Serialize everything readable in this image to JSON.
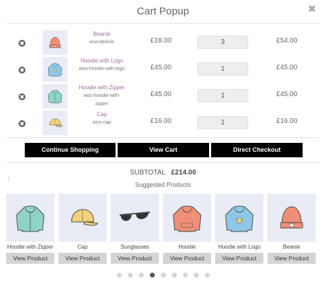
{
  "title": "Cart Popup",
  "close_icon": "close-icon",
  "cart": [
    {
      "name": "Beanie",
      "sku": "woo-beanie",
      "price": "£18.00",
      "qty": "3",
      "total": "£54.00",
      "icon": "beanie",
      "color": "#ef8f78"
    },
    {
      "name": "Hoodie with Logo",
      "sku": "woo-hoodie-with-logo",
      "price": "£45.00",
      "qty": "1",
      "total": "£45.00",
      "icon": "hoodie-logo",
      "color": "#8fc7e6"
    },
    {
      "name": "Hoodie with Zipper",
      "sku": "woo-hoodie-with-zipper",
      "price": "£45.00",
      "qty": "1",
      "total": "£45.00",
      "icon": "hoodie-zipper",
      "color": "#8fd3c6"
    },
    {
      "name": "Cap",
      "sku": "woo-cap",
      "price": "£16.00",
      "qty": "1",
      "total": "£16.00",
      "icon": "cap",
      "color": "#f3d27a"
    }
  ],
  "buttons": {
    "continue": "Continue Shopping",
    "view_cart": "View Cart",
    "checkout": "Direct Checkout"
  },
  "subtotal": {
    "label": "SUBTOTAL",
    "value": "£214.00"
  },
  "suggested": {
    "title": "Suggested Products",
    "button_label": "View Product",
    "items": [
      {
        "name": "Hoodie with Zipper",
        "icon": "hoodie-zipper",
        "color": "#8fd3c6"
      },
      {
        "name": "Cap",
        "icon": "cap",
        "color": "#f3d27a"
      },
      {
        "name": "Sunglasses",
        "icon": "sunglasses",
        "color": "#333333"
      },
      {
        "name": "Hoodie",
        "icon": "hoodie",
        "color": "#ef8f78"
      },
      {
        "name": "Hoodie with Logo",
        "icon": "hoodie-logo",
        "color": "#8fc7e6"
      },
      {
        "name": "Beanie",
        "icon": "beanie",
        "color": "#ef8f78"
      }
    ]
  },
  "carousel": {
    "dots": 9,
    "active_index": 3
  }
}
